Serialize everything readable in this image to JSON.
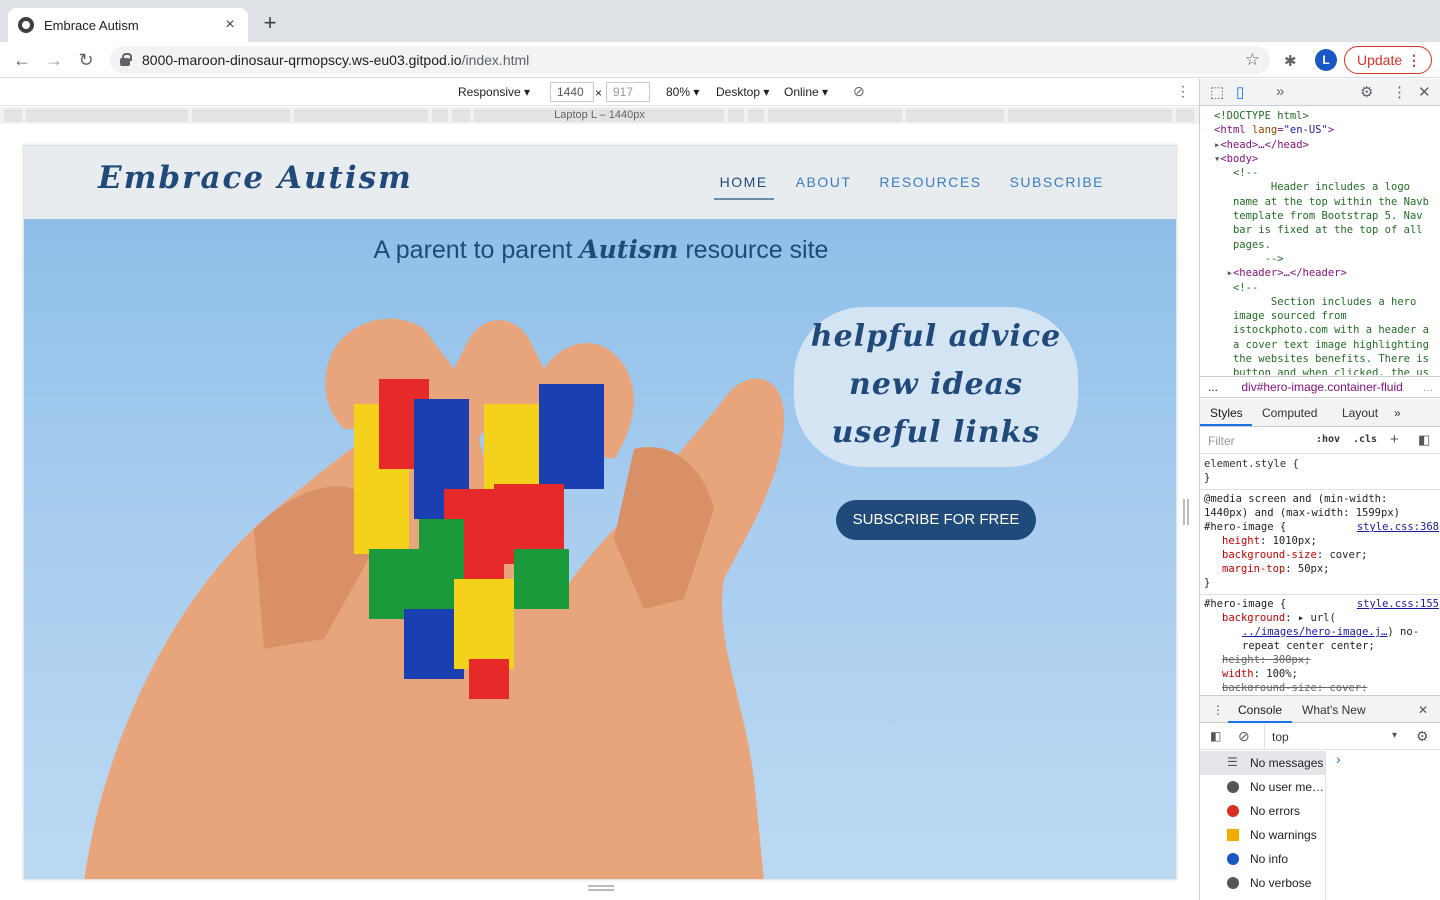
{
  "browser": {
    "tab_title": "Embrace Autism",
    "tab_close": "×",
    "new_tab": "+",
    "url_host": "8000-maroon-dinosaur-qrmopscy.ws-eu03.gitpod.io",
    "url_path": "/index.html",
    "avatar_letter": "L",
    "update_label": "Update"
  },
  "devbar": {
    "device": "Responsive",
    "width": "1440",
    "times": "×",
    "height": "917",
    "zoom": "80%",
    "mode": "Desktop",
    "network": "Online",
    "ruler_label": "Laptop L – 1440px"
  },
  "site": {
    "brand": "Embrace Autism",
    "nav": [
      "HOME",
      "ABOUT",
      "RESOURCES",
      "SUBSCRIBE"
    ],
    "tagline_before": "A parent to parent ",
    "tagline_em": "Autism",
    "tagline_after": " resource site",
    "bubble": [
      "helpful advice",
      "new ideas",
      "useful links"
    ],
    "cta": "SUBSCRIBE FOR FREE"
  },
  "devtools": {
    "crumb_more": "...",
    "crumb_node": "div#hero-image.container-fluid",
    "crumb_trail": "...",
    "style_tabs": [
      "Styles",
      "Computed",
      "Layout"
    ],
    "filter_placeholder": "Filter",
    "hov": ":hov",
    "cls": ".cls",
    "element_style": "element.style {",
    "close_brace": "}",
    "media_query": "@media screen and (min-width: 1440px) and (max-width: 1599px)",
    "selector": "#hero-image {",
    "src1": "style.css:368",
    "src2": "style.css:155",
    "p_height": "height",
    "v_height": "1010px;",
    "p_bgsize": "background-size",
    "v_bgsize": "cover;",
    "p_margin": "margin-top",
    "v_margin": "50px;",
    "p_bg": "background",
    "v_bg_a": "url(",
    "v_bg_link": "../images/hero-image.j…",
    "v_bg_b": ") no-repeat center center;",
    "strike_height": "height: 300px;",
    "p_width": "width",
    "v_width": "100%;",
    "strike_bgsize": "background-size: cover;",
    "console_tabs": [
      "Console",
      "What's New"
    ],
    "context": "top",
    "messages": [
      "No messages",
      "No user me…",
      "No errors",
      "No warnings",
      "No info",
      "No verbose"
    ],
    "prompt": "›"
  },
  "colors": {
    "accent": "#1f4a7a",
    "link": "#3a7dc3",
    "update": "#d93025"
  }
}
